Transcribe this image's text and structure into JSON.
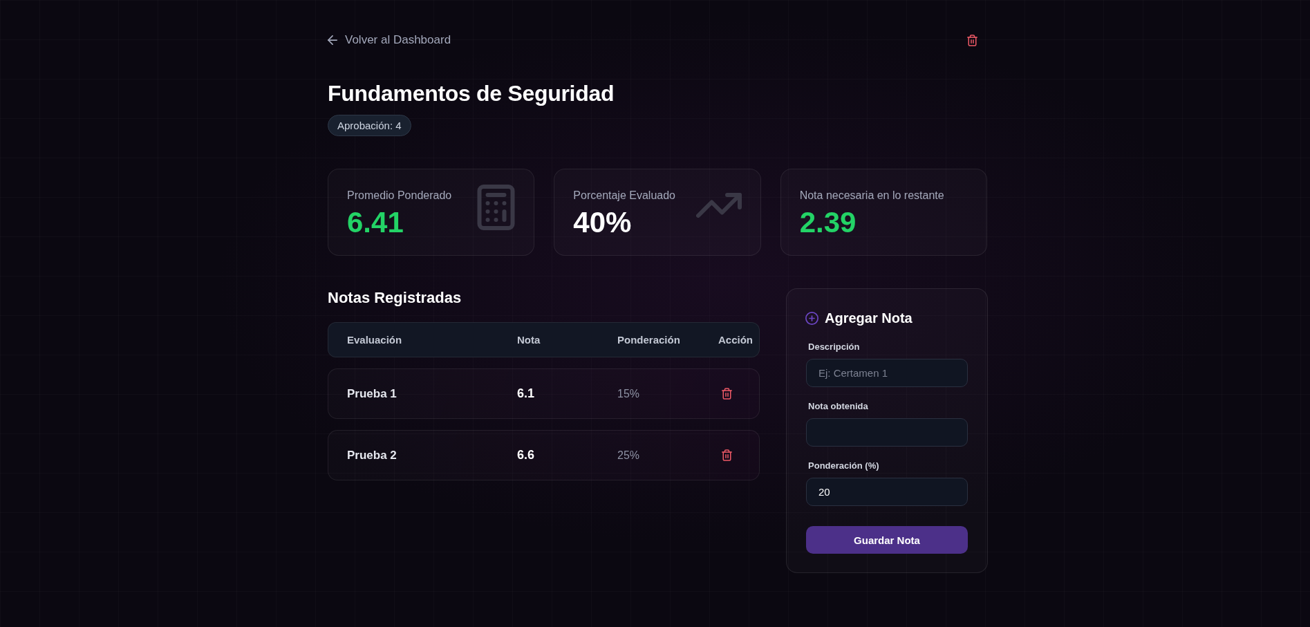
{
  "header": {
    "back_link": "Volver al Dashboard"
  },
  "course": {
    "title": "Fundamentos de Seguridad",
    "badge": "Aprobación: 4"
  },
  "stats": [
    {
      "kind": "average",
      "label": "Promedio Ponderado",
      "value": "6.41",
      "color": "#23d366"
    },
    {
      "kind": "percentage",
      "label": "Porcentaje Evaluado",
      "value": "40%",
      "color": "#ffffff"
    },
    {
      "kind": "needed",
      "label": "Nota necesaria en lo restante",
      "value": "2.39",
      "color": "#23d366"
    }
  ],
  "table": {
    "title": "Notas Registradas",
    "columns": [
      "Evaluación",
      "Nota",
      "Ponderación",
      "Acción"
    ],
    "rows": [
      {
        "evaluation": "Prueba 1",
        "grade": "6.1",
        "weight": "15%"
      },
      {
        "evaluation": "Prueba 2",
        "grade": "6.6",
        "weight": "25%"
      }
    ]
  },
  "form": {
    "title": "Agregar Nota",
    "fields": [
      {
        "label": "Descripción",
        "placeholder": "Ej: Certamen 1"
      },
      {
        "label": "Nota obtenida"
      },
      {
        "label": "Ponderación (%)",
        "value": "20"
      }
    ],
    "submit": "Guardar Nota"
  }
}
